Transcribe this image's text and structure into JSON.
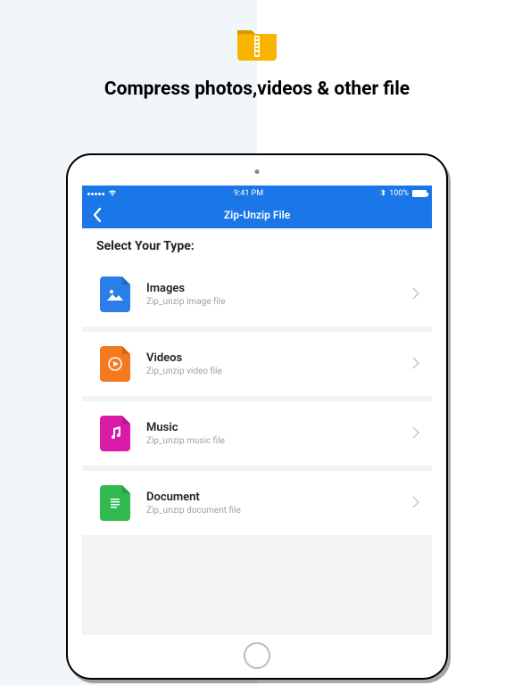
{
  "hero": {
    "title": "Compress photos,videos & other file"
  },
  "statusbar": {
    "time": "9:41 PM",
    "bluetooth": "100%"
  },
  "navbar": {
    "title": "Zip-Unzip File"
  },
  "section": {
    "header": "Select Your Type:"
  },
  "rows": [
    {
      "title": "Images",
      "subtitle": "Zip_unzip image file"
    },
    {
      "title": "Videos",
      "subtitle": "Zip_unzip video file"
    },
    {
      "title": "Music",
      "subtitle": "Zip_unzip music file"
    },
    {
      "title": "Document",
      "subtitle": "Zip_unzip document file"
    }
  ]
}
